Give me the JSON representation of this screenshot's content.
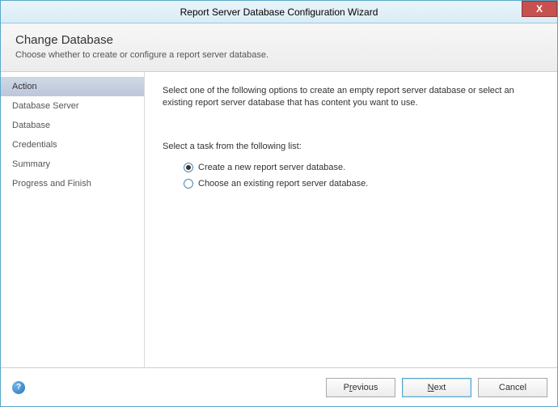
{
  "titlebar": {
    "title": "Report Server Database Configuration Wizard",
    "close": "X"
  },
  "header": {
    "heading": "Change Database",
    "sub": "Choose whether to create or configure a report server database."
  },
  "sidebar": {
    "steps": [
      {
        "label": "Action",
        "active": true
      },
      {
        "label": "Database Server",
        "active": false
      },
      {
        "label": "Database",
        "active": false
      },
      {
        "label": "Credentials",
        "active": false
      },
      {
        "label": "Summary",
        "active": false
      },
      {
        "label": "Progress and Finish",
        "active": false
      }
    ]
  },
  "main": {
    "instruction": "Select one of the following options to create an empty report server database or select an existing report server database that has content you want to use.",
    "task_label": "Select a task from the following list:",
    "options": [
      {
        "label": "Create a new report server database.",
        "checked": true
      },
      {
        "label": "Choose an existing report server database.",
        "checked": false
      }
    ]
  },
  "footer": {
    "help": "?",
    "previous_pre": "P",
    "previous_u": "r",
    "previous_post": "evious",
    "next_pre": "",
    "next_u": "N",
    "next_post": "ext",
    "cancel": "Cancel"
  }
}
